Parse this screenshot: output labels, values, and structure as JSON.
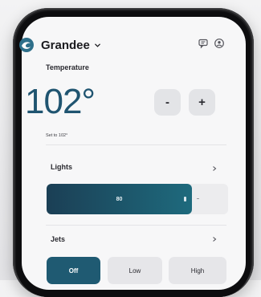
{
  "header": {
    "spa_name": "Grandee",
    "logo_icon": "swirl-logo-icon",
    "chat_icon": "chat-bubble-icon",
    "account_icon": "user-circle-icon"
  },
  "temperature": {
    "section_label": "Temperature",
    "value": "102°",
    "setpoint_text": "Set to 102°",
    "minus_label": "-",
    "plus_label": "+"
  },
  "lights": {
    "section_label": "Lights",
    "brightness_text": "80",
    "brightness_level": 0.8
  },
  "jets": {
    "section_label": "Jets",
    "options": [
      "Off",
      "Low",
      "High"
    ],
    "selected": "Off"
  },
  "colors": {
    "accent": "#1f5a72",
    "temperature_text": "#1f5470",
    "slider_start": "#1b3f55",
    "slider_end": "#1e6a7d"
  }
}
